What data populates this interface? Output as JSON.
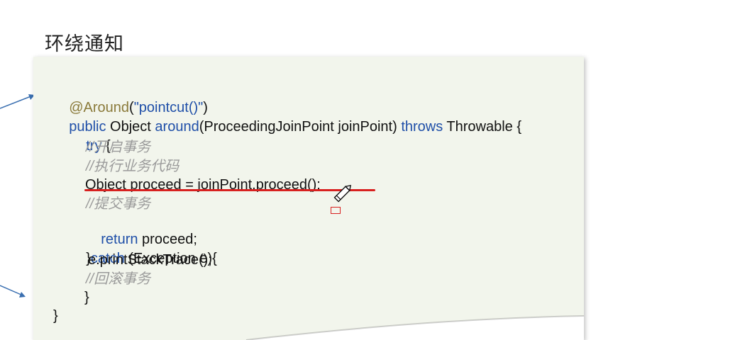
{
  "slide": {
    "title": "环绕通知"
  },
  "code": {
    "line1": {
      "annotation": "@Around",
      "open": "(",
      "arg": "\"pointcut()\"",
      "close": ")"
    },
    "line2": {
      "kw_public": "public",
      "text1": " Object ",
      "kw_around": "around",
      "text2": "(ProceedingJoinPoint joinPoint) ",
      "kw_throws": "throws",
      "text3": " Throwable {"
    },
    "line3": {
      "kw_try": "try",
      "text": " {"
    },
    "line4": {
      "comment": "//开启事务"
    },
    "line5": {
      "comment": "//执行业务代码"
    },
    "line6": {
      "text": "Object proceed = joinPoint.proceed();"
    },
    "line7": {
      "comment": "//提交事务"
    },
    "line8": {
      "kw_return": "return",
      "text": " proceed;"
    },
    "line9": {
      "brace": "}",
      "kw_catch": "catch",
      "text": " (Exception e){"
    },
    "line10": {
      "text": "e.printStackTrace();"
    },
    "line11": {
      "comment": "//回滚事务"
    },
    "line12": {
      "text": "}"
    },
    "line13": {
      "text": "}"
    }
  },
  "colors": {
    "keyword": "#1f4fa8",
    "annotation": "#8a7a3a",
    "comment": "#9a9a9a",
    "underline": "#d8201f",
    "card_background": "#f2f5ec"
  }
}
